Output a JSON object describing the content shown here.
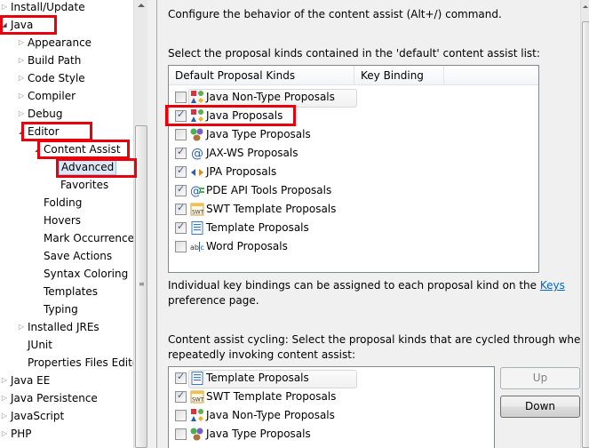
{
  "tree": {
    "items": [
      {
        "label": "Install/Update",
        "level": 0,
        "toggle": "collapsed"
      },
      {
        "label": "Java",
        "level": 0,
        "toggle": "expanded",
        "highlighted": true
      },
      {
        "label": "Appearance",
        "level": 1,
        "toggle": "collapsed"
      },
      {
        "label": "Build Path",
        "level": 1,
        "toggle": "collapsed"
      },
      {
        "label": "Code Style",
        "level": 1,
        "toggle": "collapsed"
      },
      {
        "label": "Compiler",
        "level": 1,
        "toggle": "collapsed"
      },
      {
        "label": "Debug",
        "level": 1,
        "toggle": "collapsed"
      },
      {
        "label": "Editor",
        "level": 1,
        "toggle": "expanded",
        "highlighted": true
      },
      {
        "label": "Content Assist",
        "level": 2,
        "toggle": "expanded",
        "highlighted": true
      },
      {
        "label": "Advanced",
        "level": 3,
        "toggle": "none",
        "selected": true,
        "highlighted": true
      },
      {
        "label": "Favorites",
        "level": 3,
        "toggle": "none"
      },
      {
        "label": "Folding",
        "level": 2,
        "toggle": "none"
      },
      {
        "label": "Hovers",
        "level": 2,
        "toggle": "none"
      },
      {
        "label": "Mark Occurrences",
        "level": 2,
        "toggle": "none"
      },
      {
        "label": "Save Actions",
        "level": 2,
        "toggle": "none"
      },
      {
        "label": "Syntax Coloring",
        "level": 2,
        "toggle": "none"
      },
      {
        "label": "Templates",
        "level": 2,
        "toggle": "none"
      },
      {
        "label": "Typing",
        "level": 2,
        "toggle": "none"
      },
      {
        "label": "Installed JREs",
        "level": 1,
        "toggle": "collapsed"
      },
      {
        "label": "JUnit",
        "level": 1,
        "toggle": "none"
      },
      {
        "label": "Properties Files Editor",
        "level": 1,
        "toggle": "none"
      },
      {
        "label": "Java EE",
        "level": 0,
        "toggle": "collapsed"
      },
      {
        "label": "Java Persistence",
        "level": 0,
        "toggle": "collapsed"
      },
      {
        "label": "JavaScript",
        "level": 0,
        "toggle": "collapsed"
      },
      {
        "label": "PHP",
        "level": 0,
        "toggle": "collapsed"
      }
    ]
  },
  "page": {
    "intro": "Configure the behavior of the content assist (Alt+/) command.",
    "default_list_label": "Select the proposal kinds contained in the 'default' content assist list:",
    "default_table": {
      "columns": [
        "Default Proposal Kinds",
        "Key Binding"
      ],
      "rows": [
        {
          "label": "Java Non-Type Proposals",
          "checked": false,
          "icon": "java-non-type-icon",
          "focused": true
        },
        {
          "label": "Java Proposals",
          "checked": true,
          "icon": "java-proposals-icon",
          "highlighted": true
        },
        {
          "label": "Java Type Proposals",
          "checked": false,
          "icon": "java-type-icon"
        },
        {
          "label": "JAX-WS Proposals",
          "checked": true,
          "icon": "at-sign-icon"
        },
        {
          "label": "JPA Proposals",
          "checked": true,
          "icon": "jpa-arrows-icon"
        },
        {
          "label": "PDE API Tools Proposals",
          "checked": true,
          "icon": "pde-api-icon"
        },
        {
          "label": "SWT Template Proposals",
          "checked": true,
          "icon": "swt-template-icon"
        },
        {
          "label": "Template Proposals",
          "checked": true,
          "icon": "template-icon"
        },
        {
          "label": "Word Proposals",
          "checked": false,
          "icon": "word-icon"
        }
      ]
    },
    "keys_note_prefix": "Individual key bindings can be assigned to each proposal kind on the ",
    "keys_link": "Keys",
    "keys_note_suffix": "preference page.",
    "cycling_label_line1": "Content assist cycling: Select the proposal kinds that are cycled through when",
    "cycling_label_line2": "repeatedly invoking content assist:",
    "cycling_table": {
      "rows": [
        {
          "label": "Template Proposals",
          "checked": true,
          "icon": "template-icon",
          "focused": true
        },
        {
          "label": "SWT Template Proposals",
          "checked": true,
          "icon": "swt-template-icon"
        },
        {
          "label": "Java Non-Type Proposals",
          "checked": false,
          "icon": "java-non-type-icon"
        },
        {
          "label": "Java Type Proposals",
          "checked": false,
          "icon": "java-type-icon"
        }
      ]
    },
    "buttons": {
      "up": "Up",
      "down": "Down"
    }
  },
  "colors": {
    "highlight_red": "#e8000b",
    "link": "#0066cc",
    "selection": "#dce8f7"
  }
}
